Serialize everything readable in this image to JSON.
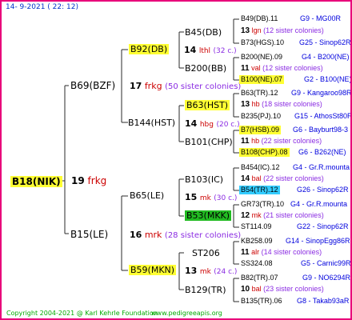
{
  "header": {
    "date": "14-  9-2021 (  22:  12)"
  },
  "footer": {
    "copyright": "Copyright 2004-2021 @ Karl Kehrle Foundation",
    "site": "www.pedigreeapis.org"
  },
  "colors": {
    "frame": "#e8007a",
    "lines": "#2a2a2a",
    "highlight_yellow": "#ffff33",
    "highlight_cyan": "#33ccff",
    "highlight_green": "#22bb22",
    "site_text": "#0033cc",
    "footer_text": "#00aa00",
    "lineage_blue": "#0000dd",
    "colony_purple": "#8a2be2",
    "name_red": "#cc0000"
  },
  "gen0": {
    "name": "B18(NIK)",
    "count": "19",
    "tag": "frkg"
  },
  "gen1": [
    {
      "name": "B69(BZF)",
      "count": "17",
      "tag": "frkg",
      "sisters": "(50 sister colonies)"
    },
    {
      "name": "B15(LE)",
      "count": "16",
      "tag": "mrk",
      "sisters": "(28 sister colonies)"
    }
  ],
  "gen2": [
    {
      "name": "B92(DB)",
      "count": "14",
      "tag": "lthl",
      "sisters": "(32 c.)"
    },
    {
      "name": "B144(HST)",
      "count": "14",
      "tag": "hbg",
      "sisters": "(20 c.)"
    },
    {
      "name": "B65(LE)",
      "count": "15",
      "tag": "mk",
      "sisters": "(30 c.)"
    },
    {
      "name": "B59(MKN)",
      "count": "13",
      "tag": "mk",
      "sisters": "(24 c.)"
    }
  ],
  "gen3": [
    {
      "name": "B45(DB)"
    },
    {
      "name": "B200(BB)"
    },
    {
      "name": "B63(HST)"
    },
    {
      "name": "B101(CHP)"
    },
    {
      "name": "B103(IC)"
    },
    {
      "name": "B53(MKK)"
    },
    {
      "name": "ST206"
    },
    {
      "name": "B129(TR)"
    }
  ],
  "gen4": [
    {
      "top": "B49(DB).11",
      "top_r": "G9 - MG00R",
      "count": "13",
      "tag": "lgn",
      "sisters": "(12 sister colonies)",
      "bot": "B73(HGS).10",
      "bot_r": "G25 - Sinop62R"
    },
    {
      "top": "B200(NE).09",
      "top_r": "G4 - B200(NE)",
      "count": "11",
      "tag": "val",
      "sisters": "(12 sister colonies)",
      "bot": "B100(NE).07",
      "bot_r": "G2 - B100(NE)"
    },
    {
      "top": "B63(TR).12",
      "top_r": "G9 - Kangaroo98R",
      "count": "13",
      "tag": "hb",
      "sisters": "(18 sister colonies)",
      "bot": "B235(PJ).10",
      "bot_r": "G15 - AthosSt80R"
    },
    {
      "top": "B7(HSB).09",
      "top_r": "G6 - Bayburt98-3",
      "count": "11",
      "tag": "hb",
      "sisters": "(22 sister colonies)",
      "bot": "B108(CHP).08",
      "bot_r": "G6 - B262(NE)"
    },
    {
      "top": "B454(IC).12",
      "top_r": "G4 - Gr.R.mounta",
      "count": "14",
      "tag": "bal",
      "sisters": "(22 sister colonies)",
      "bot": "B54(TR).12",
      "bot_r": "G26 - Sinop62R"
    },
    {
      "top": "GR73(TR).10",
      "top_r": "G4 - Gr.R.mounta",
      "count": "12",
      "tag": "mk",
      "sisters": "(21 sister colonies)",
      "bot": "ST114.09",
      "bot_r": "G22 - Sinop62R"
    },
    {
      "top": "KB258.09",
      "top_r": "G14 - SinopEgg86R",
      "count": "11",
      "tag": "alr",
      "sisters": "(14 sister colonies)",
      "bot": "SS324.08",
      "bot_r": "G5 - Carnic99R"
    },
    {
      "top": "B82(TR).07",
      "top_r": "G9 - NO6294R",
      "count": "10",
      "tag": "bal",
      "sisters": "(23 sister colonies)",
      "bot": "B135(TR).06",
      "bot_r": "G8 - Takab93aR"
    }
  ]
}
